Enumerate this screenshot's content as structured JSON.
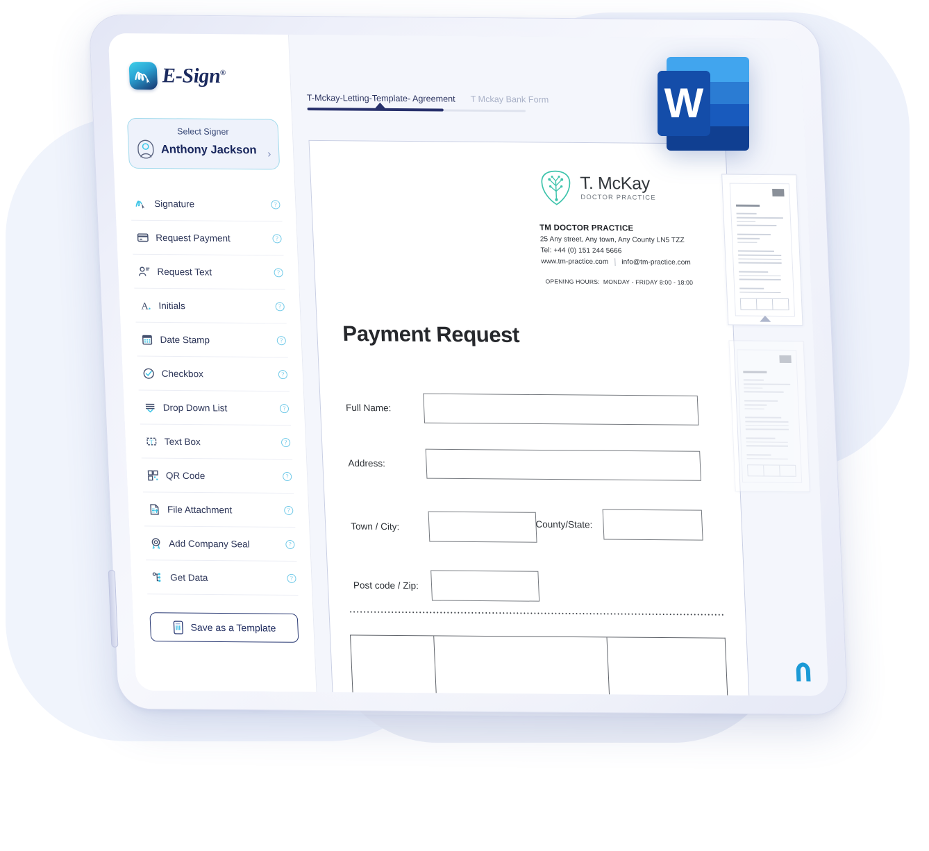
{
  "app": {
    "logo_text": "E-Sign",
    "logo_registered": "®",
    "logo_icon": "signature-squiggle-icon"
  },
  "signer": {
    "label": "Select Signer",
    "name": "Anthony Jackson",
    "avatar_icon": "person-icon",
    "chevron_icon": "chevron-right-icon"
  },
  "tools": [
    {
      "label": "Signature",
      "icon": "signature-icon",
      "help": "?"
    },
    {
      "label": "Request Payment",
      "icon": "credit-card-icon",
      "help": "?"
    },
    {
      "label": "Request Text",
      "icon": "person-text-icon",
      "help": "?"
    },
    {
      "label": "Initials",
      "icon": "letter-a-icon",
      "help": "?"
    },
    {
      "label": "Date Stamp",
      "icon": "calendar-icon",
      "help": "?"
    },
    {
      "label": "Checkbox",
      "icon": "check-circle-icon",
      "help": "?"
    },
    {
      "label": "Drop Down List",
      "icon": "dropdown-icon",
      "help": "?"
    },
    {
      "label": "Text Box",
      "icon": "text-box-icon",
      "help": "?"
    },
    {
      "label": "QR Code",
      "icon": "qr-code-icon",
      "help": "?"
    },
    {
      "label": "File Attachment",
      "icon": "file-upload-icon",
      "help": "?"
    },
    {
      "label": "Add Company Seal",
      "icon": "seal-icon",
      "help": "?"
    },
    {
      "label": "Get Data",
      "icon": "get-data-icon",
      "help": "?"
    }
  ],
  "save_template": {
    "label": "Save as a Template",
    "icon": "document-icon"
  },
  "tabs": [
    {
      "label": "T-Mckay-Letting-Template- Agreement",
      "active": true
    },
    {
      "label": "T Mckay Bank Form",
      "active": false
    }
  ],
  "document": {
    "letterhead": {
      "logo_icon": "tree-heart-icon",
      "brand_name": "T. McKay",
      "brand_sub": "DOCTOR PRACTICE",
      "company": "TM DOCTOR PRACTICE",
      "address": "25 Any street, Any town, Any County LN5 TZZ",
      "telephone": "Tel: +44 (0) 151 244 5666",
      "website": "www.tm-practice.com",
      "email": "info@tm-practice.com",
      "hours_label": "OPENING HOURS:",
      "hours_value": "MONDAY - FRIDAY 8:00 - 18:00"
    },
    "title": "Payment Request",
    "fields": [
      {
        "label": "Full Name:",
        "name": "full-name"
      },
      {
        "label": "Address:",
        "name": "address"
      },
      {
        "label": "Town / City:",
        "name": "town-city"
      },
      {
        "label": "County/State:",
        "name": "county-state"
      },
      {
        "label": "Post code / Zip:",
        "name": "post-code-zip"
      }
    ]
  },
  "thumbnails": [
    {
      "index": 1,
      "active": true
    },
    {
      "index": 2,
      "active": false
    }
  ],
  "word_icon": {
    "letter": "W",
    "name": "microsoft-word-icon"
  },
  "corner_logo": {
    "name": "arch-logo-icon"
  },
  "colors": {
    "accent_navy": "#27306b",
    "accent_cyan": "#6fc9e8",
    "sidebar_bg": "#ffffff",
    "main_bg": "#f4f6fc",
    "word_blue": "#2b579a"
  }
}
